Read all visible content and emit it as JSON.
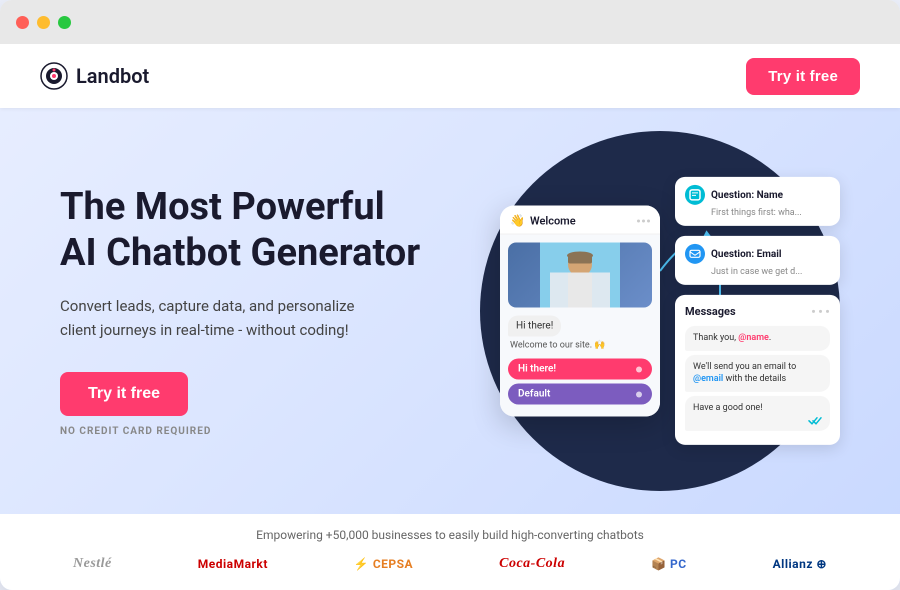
{
  "browser": {
    "dots": [
      "red",
      "yellow",
      "green"
    ]
  },
  "header": {
    "logo_text": "Landbot",
    "try_btn": "Try it free"
  },
  "hero": {
    "headline_line1": "The Most Powerful",
    "headline_line2": "AI Chatbot Generator",
    "subtext": "Convert leads, capture data, and personalize client journeys in real-time - without coding!",
    "cta_btn": "Try it free",
    "no_credit": "NO CREDIT CARD REQUIRED"
  },
  "phone_mockup": {
    "header": "Welcome",
    "hi_there": "Hi there!",
    "welcome_msg": "Welcome to our site. 🙌",
    "option1": "Hi there!",
    "option2": "Default"
  },
  "flow_cards": {
    "card1_title": "Question: Name",
    "card1_sub": "First things first: wha...",
    "card2_title": "Question: Email",
    "card2_sub": "Just in case we get d...",
    "messages_title": "Messages",
    "msg1": "Thank you, @name.",
    "msg2": "We'll send you an email to @email with the details",
    "msg3": "Have a good one!"
  },
  "bottom": {
    "empowering": "Empowering +50,000 businesses to easily build high-converting chatbots",
    "brands": [
      "Nestlé",
      "MediaMarkt",
      "CEPSA",
      "Coca-Cola",
      "PC",
      "Allianz"
    ]
  }
}
